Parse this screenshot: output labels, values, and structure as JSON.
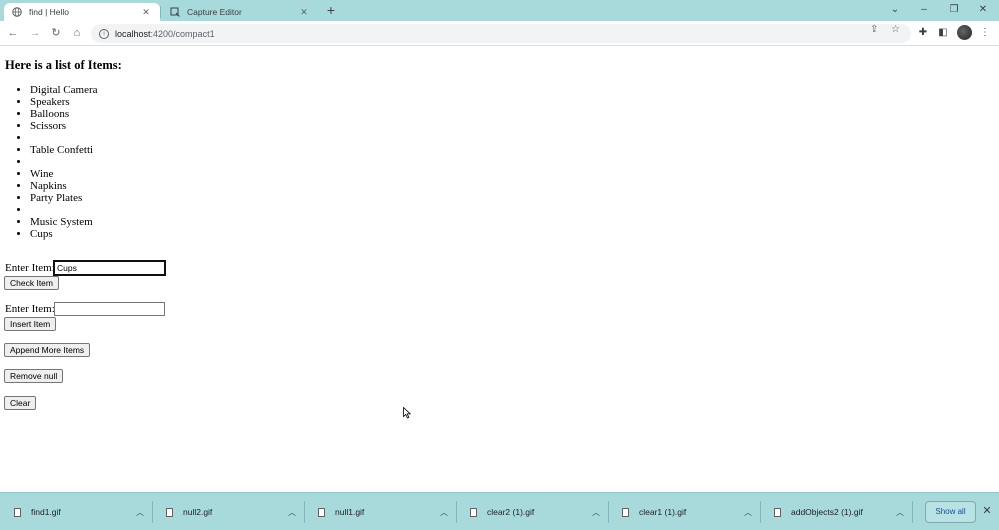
{
  "browser": {
    "tabs": [
      {
        "title": "find | Hello",
        "active": true
      },
      {
        "title": "Capture Editor",
        "active": false
      }
    ],
    "address": {
      "host": "localhost",
      "path": ":4200/compact1"
    }
  },
  "page": {
    "heading": "Here is a list of Items:",
    "items": [
      "Digital Camera",
      "Speakers",
      "Balloons",
      "Scissors",
      "",
      "Table Confetti",
      "",
      "Wine",
      "Napkins",
      "Party Plates",
      "",
      "Music System",
      "Cups"
    ],
    "check_form": {
      "label": "Enter Item:",
      "value": "Cups",
      "button": "Check Item"
    },
    "insert_form": {
      "label": "Enter Item:",
      "value": "",
      "button": "Insert Item"
    },
    "buttons": {
      "append": "Append More Items",
      "remove_null": "Remove null",
      "clear": "Clear"
    }
  },
  "downloads": {
    "files": [
      "find1.gif",
      "null2.gif",
      "null1.gif",
      "clear2 (1).gif",
      "clear1 (1).gif",
      "addObjects2 (1).gif"
    ],
    "show_all": "Show all"
  },
  "colors": {
    "chrome_accent": "#a8dadc"
  }
}
